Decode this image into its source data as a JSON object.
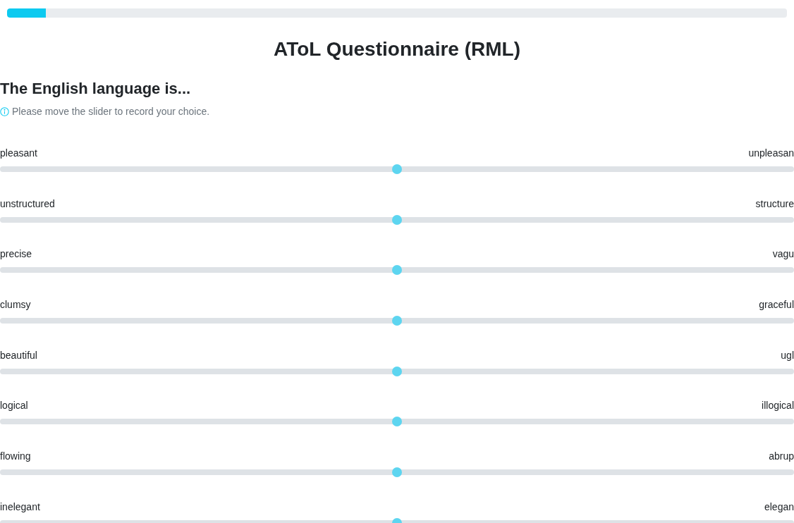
{
  "progress": {
    "level": 0.05
  },
  "title": "AToL Questionnaire (RML)",
  "question": "The English language is...",
  "hint": "Please move the slider to record your choice.",
  "scales": [
    {
      "left": "pleasant",
      "right": "unpleasan",
      "level": 0.5
    },
    {
      "left": "unstructured",
      "right": "structure",
      "level": 0.5
    },
    {
      "left": "precise",
      "right": "vagu",
      "level": 0.5
    },
    {
      "left": "clumsy",
      "right": "graceful",
      "level": 0.5
    },
    {
      "left": "beautiful",
      "right": "ugl",
      "level": 0.5
    },
    {
      "left": "logical",
      "right": "illogical",
      "level": 0.5
    },
    {
      "left": "flowing",
      "right": "abrup",
      "level": 0.5
    },
    {
      "left": "inelegant",
      "right": "elegan",
      "level": 0.5
    }
  ]
}
